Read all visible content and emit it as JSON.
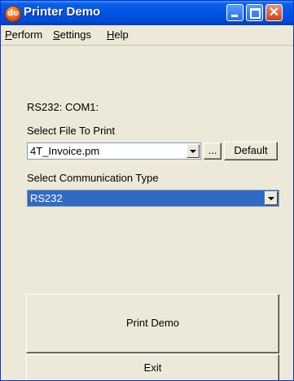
{
  "window": {
    "title": "Printer Demo",
    "app_icon": "do"
  },
  "menu": {
    "items": [
      "Perform",
      "Settings",
      "Help"
    ]
  },
  "status": {
    "port_text": "RS232: COM1:"
  },
  "file_select": {
    "label": "Select File To Print",
    "value": "4T_Invoice.pm",
    "browse_label": "...",
    "default_label": "Default"
  },
  "comm_select": {
    "label": "Select Communication Type",
    "value": "RS232"
  },
  "buttons": {
    "print_demo": "Print Demo",
    "exit": "Exit"
  }
}
